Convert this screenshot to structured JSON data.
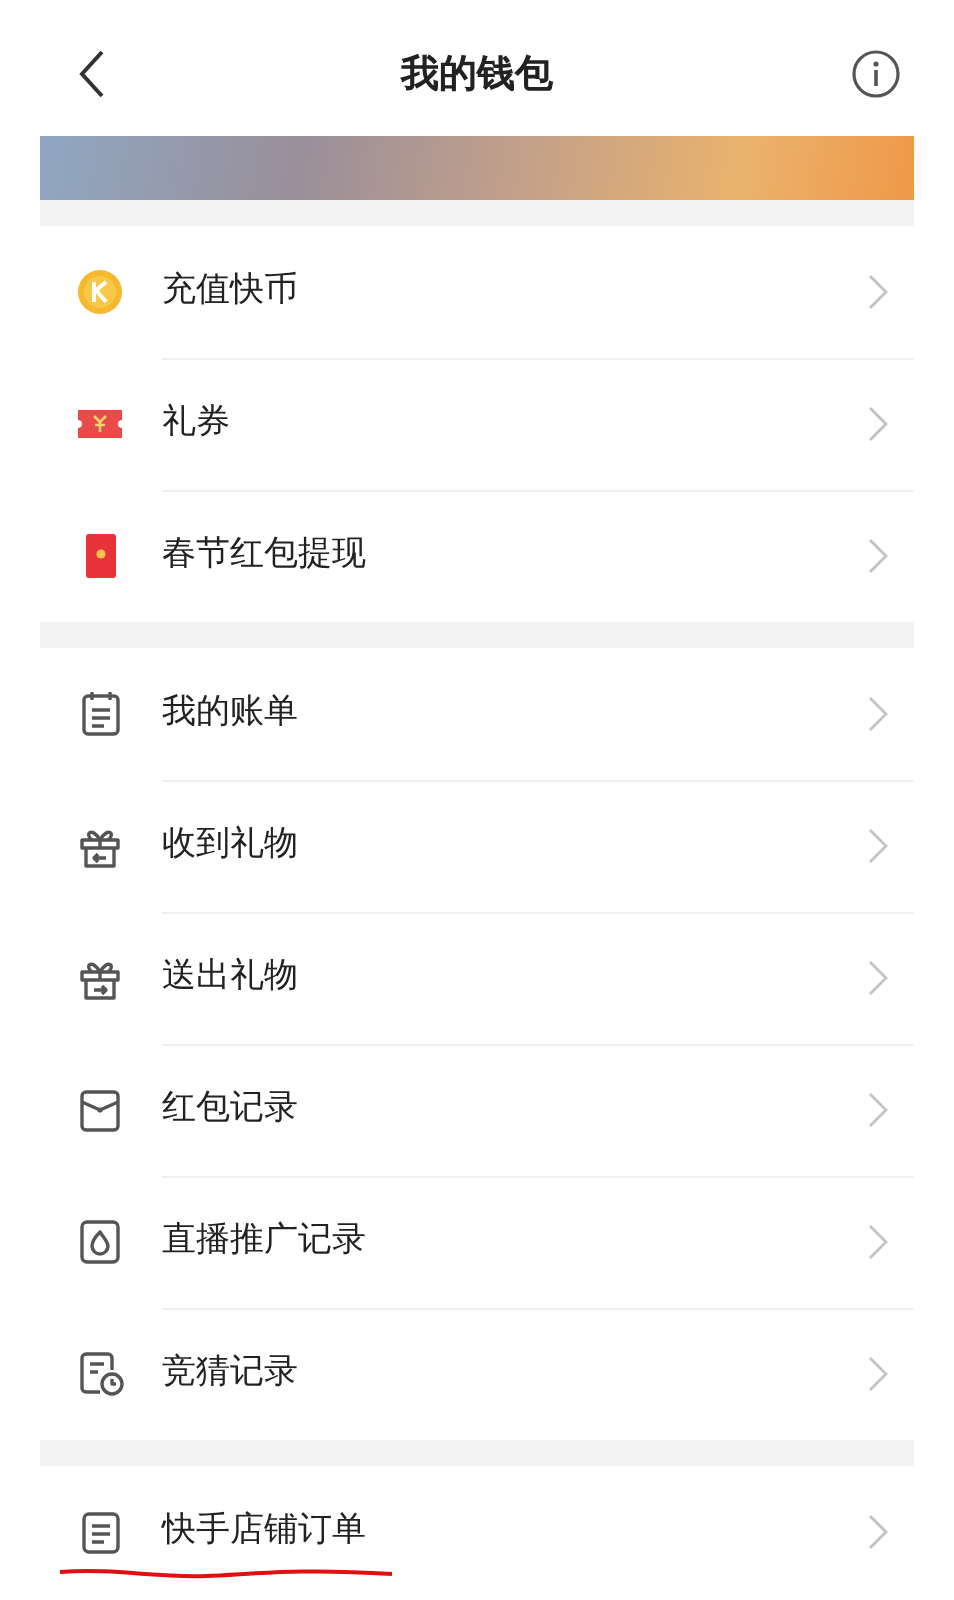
{
  "header": {
    "title": "我的钱包"
  },
  "groups": [
    {
      "items": [
        {
          "label": "充值快币",
          "kind": "coin",
          "underlined": false
        },
        {
          "label": "礼券",
          "kind": "voucher",
          "underlined": false
        },
        {
          "label": "春节红包提现",
          "kind": "red-packet",
          "underlined": false
        }
      ]
    },
    {
      "items": [
        {
          "label": "我的账单",
          "kind": "bill",
          "underlined": false
        },
        {
          "label": "收到礼物",
          "kind": "gift-in",
          "underlined": false
        },
        {
          "label": "送出礼物",
          "kind": "gift-out",
          "underlined": false
        },
        {
          "label": "红包记录",
          "kind": "envelope",
          "underlined": false
        },
        {
          "label": "直播推广记录",
          "kind": "promo",
          "underlined": false
        },
        {
          "label": "竞猜记录",
          "kind": "guess",
          "underlined": false
        }
      ]
    },
    {
      "items": [
        {
          "label": "快手店铺订单",
          "kind": "order",
          "underlined": true
        }
      ]
    }
  ]
}
